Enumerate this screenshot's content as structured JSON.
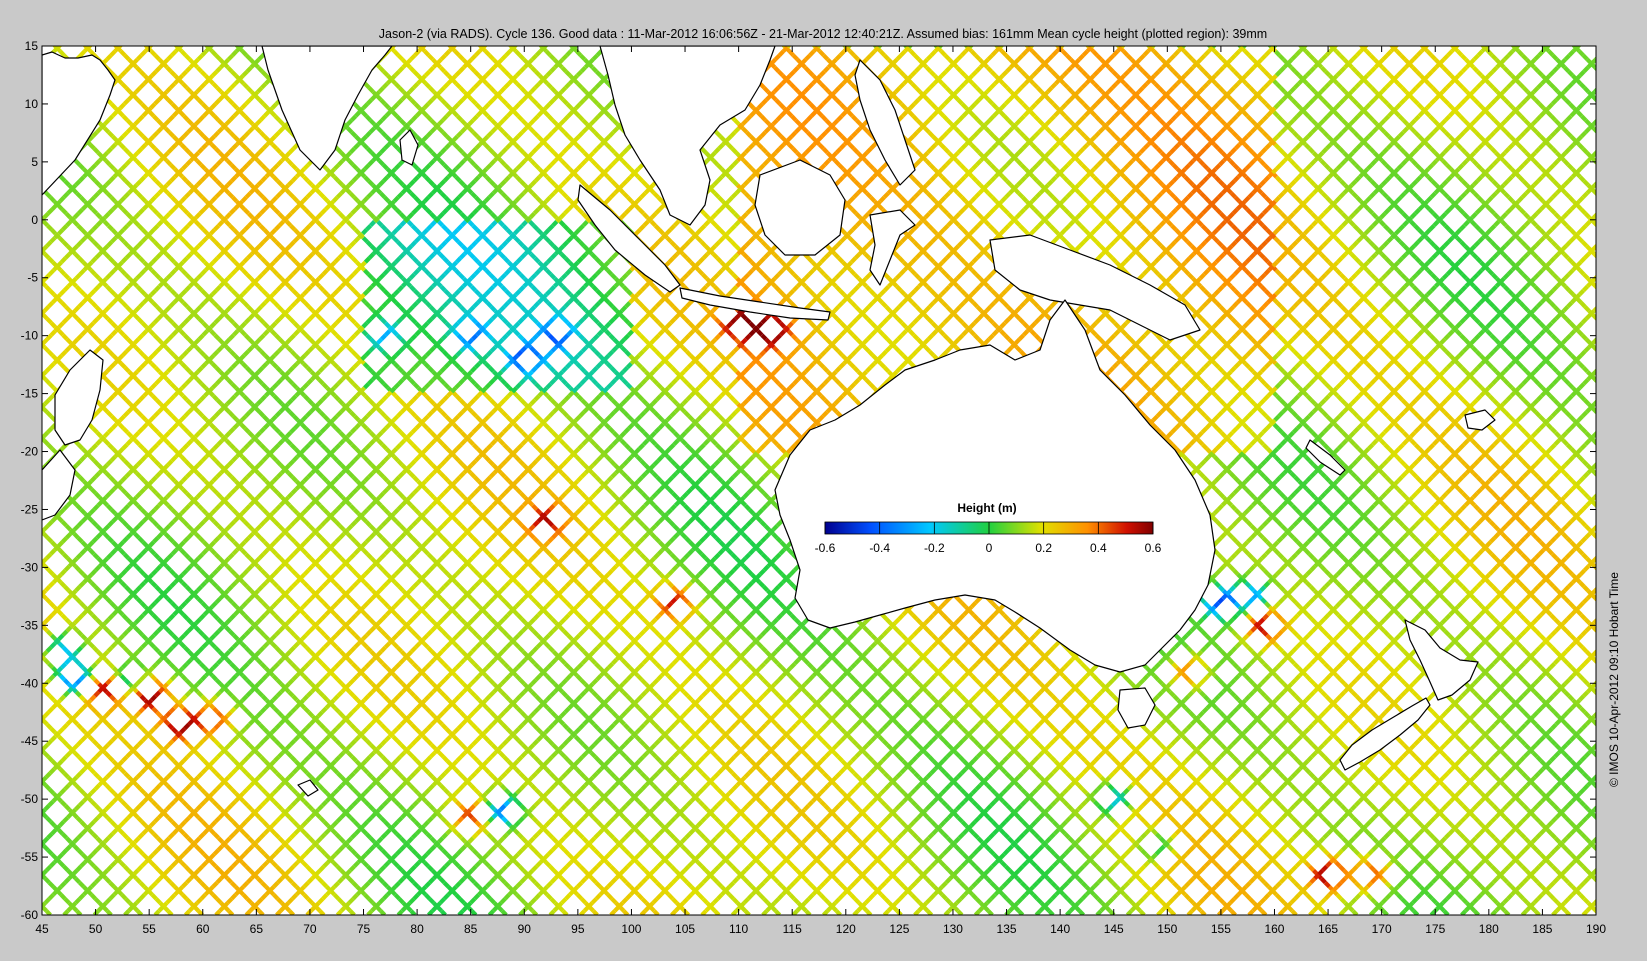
{
  "title": "Jason-2 (via RADS). Cycle 136. Good data : 11-Mar-2012 16:06:56Z - 21-Mar-2012 12:40:21Z. Assumed bias: 161mm  Mean cycle height (plotted region): 39mm",
  "credit": "© IMOS 10-Apr-2012 09:10 Hobart Time",
  "map": {
    "lon_range": [
      45,
      190
    ],
    "lat_range": [
      -60,
      15
    ],
    "x_ticks": [
      45,
      50,
      55,
      60,
      65,
      70,
      75,
      80,
      85,
      90,
      95,
      100,
      105,
      110,
      115,
      120,
      125,
      130,
      135,
      140,
      145,
      150,
      155,
      160,
      165,
      170,
      175,
      180,
      185,
      190
    ],
    "y_ticks": [
      15,
      10,
      5,
      0,
      -5,
      -10,
      -15,
      -20,
      -25,
      -30,
      -35,
      -40,
      -45,
      -50,
      -55,
      -60
    ],
    "background_color": "#ffffff",
    "land_outline_color": "#000000"
  },
  "colorbar": {
    "label": "Height (m)",
    "ticks": [
      -0.6,
      -0.4,
      -0.2,
      0,
      0.2,
      0.4,
      0.6
    ],
    "tick_labels": [
      "-0.6",
      "-0.4",
      "-0.2",
      "0",
      "0.2",
      "0.4",
      "0.6"
    ],
    "range": [
      -0.6,
      0.6
    ],
    "colormap": [
      "#00008f",
      "#0050ff",
      "#00c8ff",
      "#20d040",
      "#e0e000",
      "#ff9000",
      "#d01000",
      "#800000"
    ]
  },
  "chart_data": {
    "type": "scatter",
    "title": "Jason-2 (via RADS). Cycle 136. Good data : 11-Mar-2012 16:06:56Z - 21-Mar-2012 12:40:21Z. Assumed bias: 161mm  Mean cycle height (plotted region): 39mm",
    "xlim": [
      45,
      190
    ],
    "ylim": [
      -60,
      15
    ],
    "color_variable": "Height (m)",
    "color_range": [
      -0.6,
      0.6
    ],
    "mean_cycle_height_mm": 39,
    "assumed_bias_mm": 161,
    "height_anomalies": [
      {
        "lon": 47,
        "lat": -37,
        "height": -0.3
      },
      {
        "lon": 48,
        "lat": -39.5,
        "height": -0.5
      },
      {
        "lon": 51,
        "lat": -40.5,
        "height": 0.5
      },
      {
        "lon": 53,
        "lat": -40,
        "height": -0.3
      },
      {
        "lon": 55,
        "lat": -41,
        "height": 0.6
      },
      {
        "lon": 58,
        "lat": -43.5,
        "height": 0.55
      },
      {
        "lon": 61,
        "lat": -43,
        "height": 0.4
      },
      {
        "lon": 77,
        "lat": -10,
        "height": -0.2
      },
      {
        "lon": 85,
        "lat": -10,
        "height": -0.2
      },
      {
        "lon": 90,
        "lat": -12,
        "height": -0.25
      },
      {
        "lon": 93,
        "lat": -10,
        "height": -0.2
      },
      {
        "lon": 92,
        "lat": -26,
        "height": 0.4
      },
      {
        "lon": 104,
        "lat": -33,
        "height": 0.45
      },
      {
        "lon": 85,
        "lat": -51.5,
        "height": 0.4
      },
      {
        "lon": 88,
        "lat": -51,
        "height": -0.4
      },
      {
        "lon": 110,
        "lat": -9,
        "height": 0.5
      },
      {
        "lon": 113,
        "lat": -9.5,
        "height": 0.5
      },
      {
        "lon": 155,
        "lat": -33,
        "height": -0.4
      },
      {
        "lon": 158,
        "lat": -32.5,
        "height": -0.3
      },
      {
        "lon": 159,
        "lat": -35,
        "height": 0.5
      },
      {
        "lon": 152,
        "lat": -39,
        "height": 0.35
      },
      {
        "lon": 165,
        "lat": -56.5,
        "height": 0.55
      },
      {
        "lon": 169,
        "lat": -56.5,
        "height": 0.4
      },
      {
        "lon": 145,
        "lat": -50,
        "height": -0.3
      },
      {
        "lon": 149,
        "lat": -54,
        "height": -0.2
      }
    ]
  }
}
